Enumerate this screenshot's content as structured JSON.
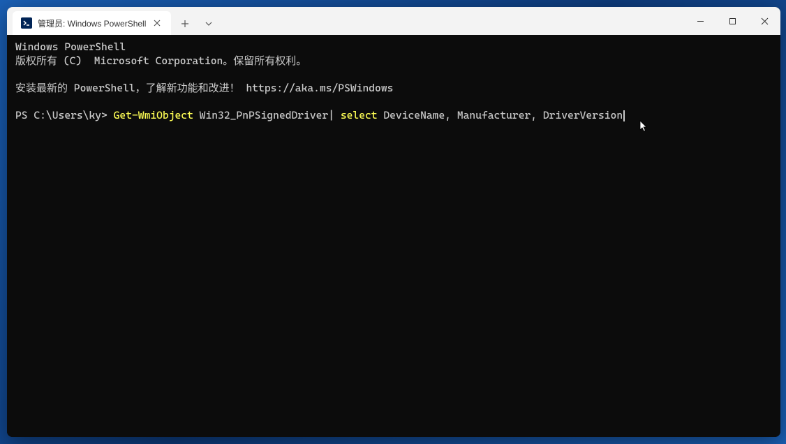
{
  "window": {
    "tab": {
      "title": "管理员: Windows PowerShell",
      "icon_label": "powershell-icon"
    },
    "controls": {
      "minimize": "minimize",
      "maximize": "maximize",
      "close": "close"
    }
  },
  "terminal": {
    "header_line1": "Windows PowerShell",
    "header_line2": "版权所有 (C)  Microsoft Corporation。保留所有权利。",
    "install_msg": "安装最新的 PowerShell，了解新功能和改进！ https://aka.ms/PSWindows",
    "prompt": "PS C:\\Users\\ky> ",
    "command": {
      "cmdlet1": "Get-WmiObject",
      "arg1": " Win32_PnPSignedDriver| ",
      "cmdlet2": "select",
      "arg2": " DeviceName, Manufacturer, DriverVersion"
    }
  }
}
